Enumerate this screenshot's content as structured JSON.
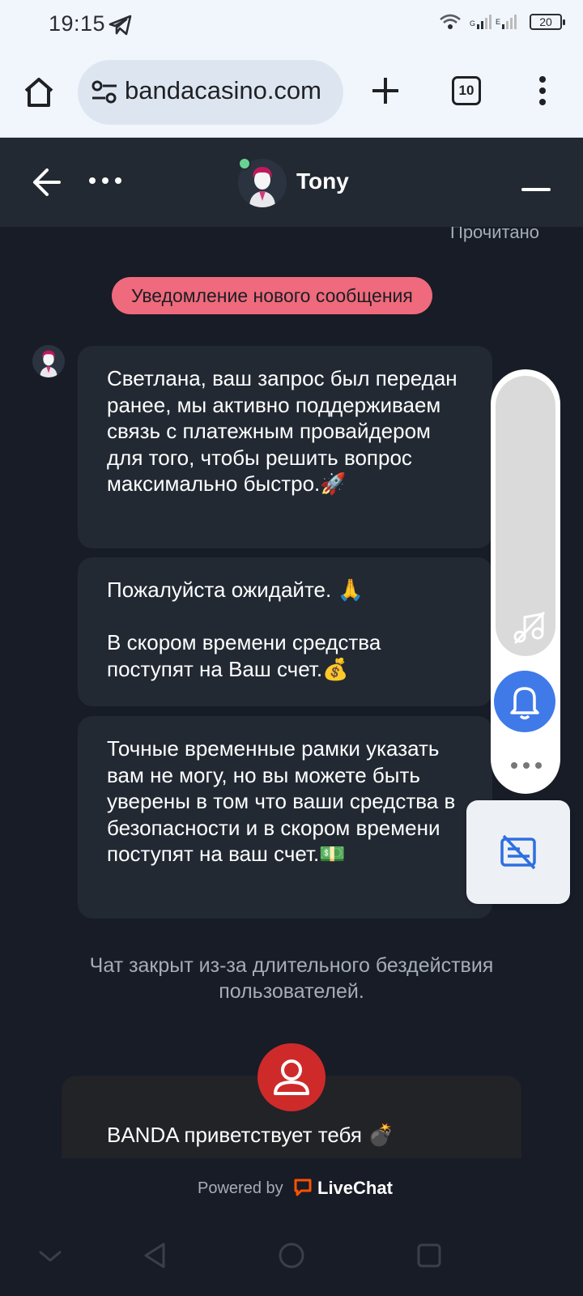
{
  "status_bar": {
    "time": "19:15",
    "battery": "20",
    "icons": [
      "telegram-icon",
      "wifi-icon",
      "signal-icon",
      "battery-icon"
    ]
  },
  "browser": {
    "url": "bandacasino.com",
    "tab_count": "10",
    "icons": [
      "home-icon",
      "site-settings-icon",
      "new-tab-icon",
      "tabs-icon",
      "menu-icon"
    ]
  },
  "chat_header": {
    "agent_name": "Tony",
    "online": true,
    "icons": [
      "back-arrow-icon",
      "more-options-icon",
      "minimize-icon"
    ]
  },
  "chat": {
    "read_receipt": "Прочитано",
    "notice": "Уведомление нового сообщения",
    "messages": [
      "Светлана, ваш запрос был передан ранее, мы активно поддерживаем связь с платежным провайдером для того, чтобы решить вопрос максимально быстро.🚀",
      "Пожалуйста ожидайте. 🙏\n\nВ скором времени средства поступят на Ваш счет.💰",
      "Точные временные рамки указать вам не могу, но вы можете быть уверены в том что ваши средства в безопасности и в скором времени поступят на ваш счет.💵"
    ],
    "closed_notice": "Чат закрыт из-за длительного бездействия пользователей.",
    "welcome_text": "BANDA приветствует тебя 💣"
  },
  "floating": {
    "icons": [
      "music-off-icon",
      "bell-icon",
      "more-dots-icon",
      "captions-off-icon"
    ]
  },
  "footer": {
    "powered_by": "Powered by",
    "brand": "LiveChat",
    "brand_color": "#fe5100"
  },
  "colors": {
    "header_bg": "#222933",
    "chat_bg": "#171c26",
    "notice_bg": "#ef6a7c",
    "bell_bg": "#3f7ae8",
    "welcome_avatar_bg": "#cf2a2a"
  },
  "nav": {
    "icons": [
      "chevron-down-icon",
      "back-triangle-icon",
      "home-circle-icon",
      "recents-square-icon"
    ]
  }
}
